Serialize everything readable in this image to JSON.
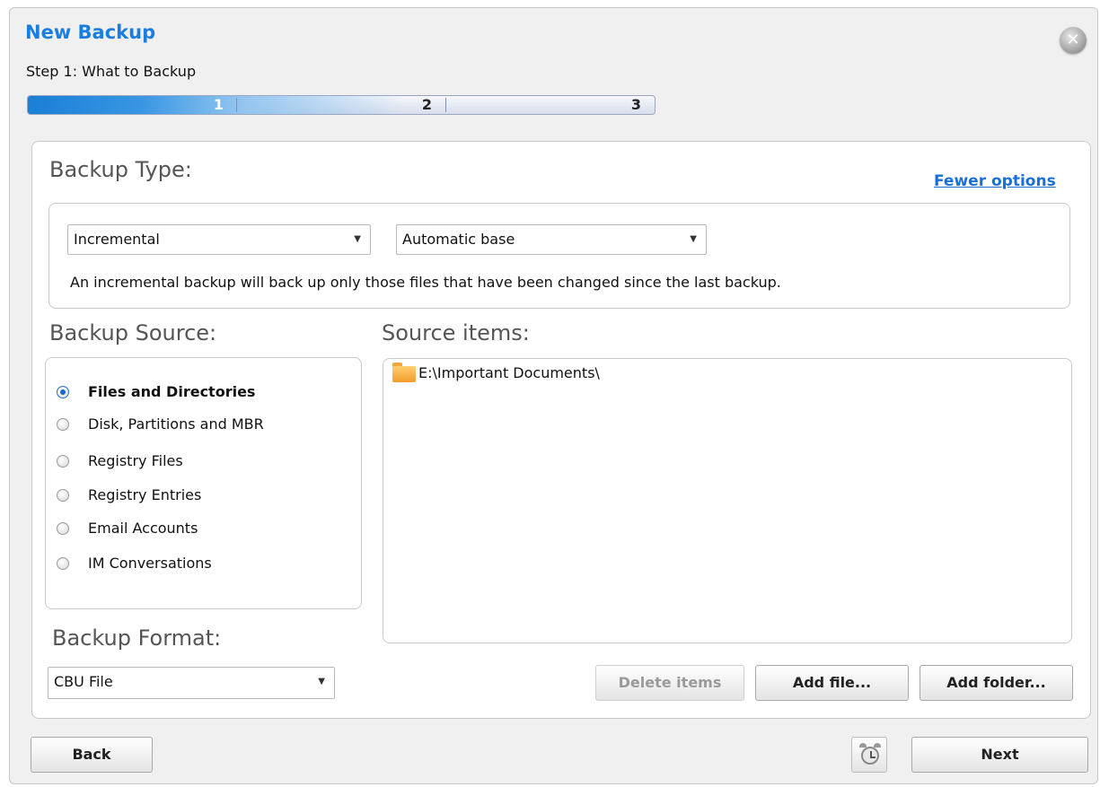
{
  "dialog": {
    "title": "New Backup",
    "step": "Step 1: What to Backup",
    "close_icon": "close-icon",
    "progress": {
      "current_step": 1,
      "fill_fraction": 0.45,
      "steps": [
        "1",
        "2",
        "3"
      ]
    }
  },
  "backup_type": {
    "heading": "Backup Type:",
    "fewer_options": "Fewer options",
    "type_value": "Incremental",
    "base_value": "Automatic base",
    "description": "An incremental backup will back up only those files that have been changed since the last backup."
  },
  "backup_source": {
    "heading": "Backup Source:",
    "options": [
      {
        "label": "Files and Directories",
        "selected": true
      },
      {
        "label": "Disk, Partitions and MBR",
        "selected": false
      },
      {
        "label": "Registry Files",
        "selected": false
      },
      {
        "label": "Registry Entries",
        "selected": false
      },
      {
        "label": "Email Accounts",
        "selected": false
      },
      {
        "label": "IM Conversations",
        "selected": false
      }
    ]
  },
  "source_items": {
    "heading": "Source items:",
    "items": [
      {
        "label": "E:\\Important Documents\\",
        "icon": "folder-icon"
      }
    ]
  },
  "backup_format": {
    "heading": "Backup Format:",
    "value": "CBU File"
  },
  "buttons": {
    "delete_items": "Delete items",
    "add_file": "Add file...",
    "add_folder": "Add folder...",
    "back": "Back",
    "next": "Next",
    "schedule_icon": "alarm-clock-icon"
  }
}
